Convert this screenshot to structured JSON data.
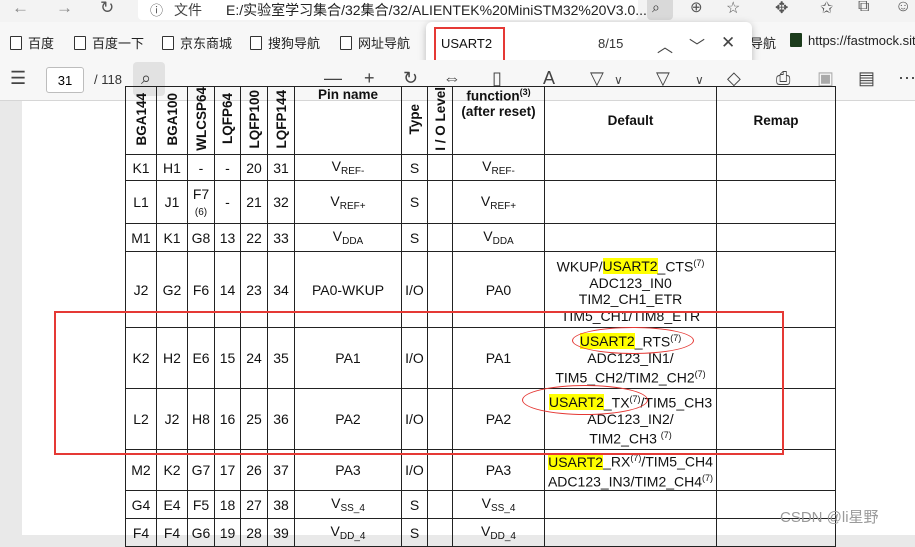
{
  "browser": {
    "file_label": "文件",
    "url": "E:/实验室学习集合/32集合/32/ALIENTEK%20MiniSTM32%20V3.0...",
    "bookmarks": [
      "百度",
      "百度一下",
      "京东商城",
      "搜狗导航",
      "网址导航",
      "导航",
      "https://fastmock.sit"
    ]
  },
  "find": {
    "query": "USART2",
    "count": "8/15"
  },
  "pdf_toolbar": {
    "page": "31",
    "total": "/ 118"
  },
  "table": {
    "headers": {
      "col1": "BGA144",
      "col2": "BGA100",
      "col3": "WLCSP64",
      "col4": "LQFP64",
      "col5": "LQFP100",
      "col6": "LQFP144",
      "pin_name": "Pin name",
      "type": "Type",
      "io": "I / O Level",
      "main_fn": "function",
      "main_fn_sup": "(3)",
      "main_fn2": "(after reset)",
      "default": "Default",
      "remap": "Remap"
    },
    "rows": [
      {
        "c1": "K1",
        "c2": "H1",
        "c3": "-",
        "c4": "-",
        "c5": "20",
        "c6": "31",
        "name": "V",
        "name_sub": "REF-",
        "type": "S",
        "fn": "V",
        "fn_sub": "REF-"
      },
      {
        "c1": "L1",
        "c2": "J1",
        "c3": "F7",
        "c3_sub": "(6)",
        "c4": "-",
        "c5": "21",
        "c6": "32",
        "name": "V",
        "name_sub": "REF+",
        "type": "S",
        "fn": "V",
        "fn_sub": "REF+"
      },
      {
        "c1": "M1",
        "c2": "K1",
        "c3": "G8",
        "c4": "13",
        "c5": "22",
        "c6": "33",
        "name": "V",
        "name_sub": "DDA",
        "type": "S",
        "fn": "V",
        "fn_sub": "DDA"
      },
      {
        "c1": "J2",
        "c2": "G2",
        "c3": "F6",
        "c4": "14",
        "c5": "23",
        "c6": "34",
        "name": "PA0-WKUP",
        "type": "I/O",
        "fn": "PA0",
        "def": [
          "WKUP/",
          "USART2",
          "_CTS",
          "(7)",
          "ADC123_IN0",
          "TIM2_CH1_ETR",
          "TIM5_CH1/TIM8_ETR"
        ]
      },
      {
        "c1": "K2",
        "c2": "H2",
        "c3": "E6",
        "c4": "15",
        "c5": "24",
        "c6": "35",
        "name": "PA1",
        "type": "I/O",
        "fn": "PA1",
        "def": [
          "USART2",
          "_RTS",
          "(7)",
          "ADC123_IN1/",
          "TIM5_CH2/TIM2_CH2",
          "(7)"
        ]
      },
      {
        "c1": "L2",
        "c2": "J2",
        "c3": "H8",
        "c4": "16",
        "c5": "25",
        "c6": "36",
        "name": "PA2",
        "type": "I/O",
        "fn": "PA2",
        "def": [
          "USART2",
          "_TX",
          "(7)",
          "/TIM5_CH3",
          "ADC123_IN2/",
          "TIM2_CH3",
          "(7)"
        ]
      },
      {
        "c1": "M2",
        "c2": "K2",
        "c3": "G7",
        "c4": "17",
        "c5": "26",
        "c6": "37",
        "name": "PA3",
        "type": "I/O",
        "fn": "PA3",
        "def": [
          "USART2",
          "_RX",
          "(7)",
          "/TIM5_CH4",
          "ADC123_IN3/TIM2_CH4",
          "(7)"
        ]
      },
      {
        "c1": "G4",
        "c2": "E4",
        "c3": "F5",
        "c4": "18",
        "c5": "27",
        "c6": "38",
        "name": "V",
        "name_sub": "SS_4",
        "type": "S",
        "fn": "V",
        "fn_sub": "SS_4"
      },
      {
        "c1": "F4",
        "c2": "F4",
        "c3": "G6",
        "c4": "19",
        "c5": "28",
        "c6": "39",
        "name": "V",
        "name_sub": "DD_4",
        "type": "S",
        "fn": "V",
        "fn_sub": "DD_4"
      }
    ]
  },
  "watermark": "CSDN @li星野",
  "colors": {
    "highlight": "#ffff00",
    "annotation_red": "#e53935"
  }
}
